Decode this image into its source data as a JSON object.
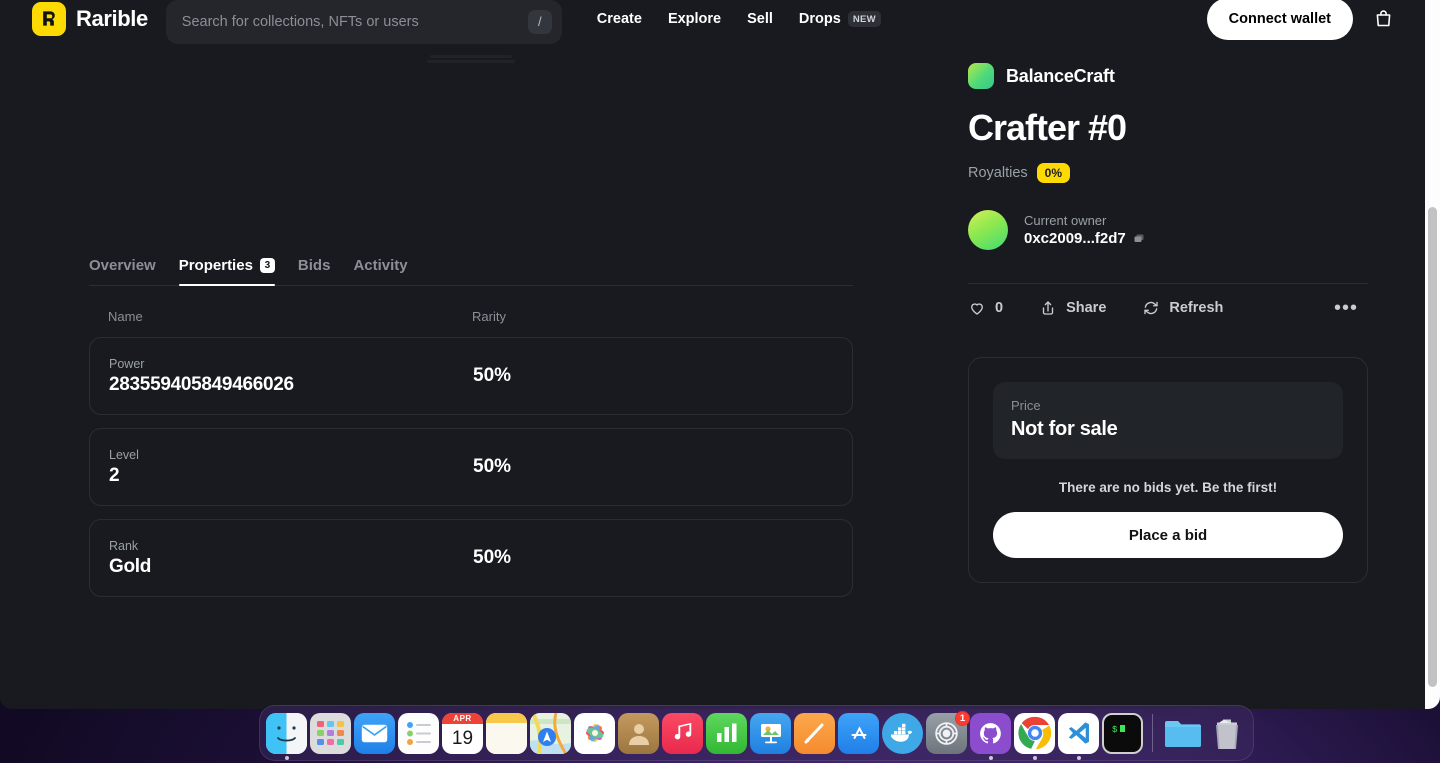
{
  "header": {
    "brand_name": "Rarible",
    "brand_logo": "rarible-logo-icon",
    "search": {
      "placeholder": "Search for collections, NFTs or users",
      "value": "",
      "shortcut_badge": "/"
    },
    "nav": [
      {
        "label": "Create",
        "badge": ""
      },
      {
        "label": "Explore",
        "badge": ""
      },
      {
        "label": "Sell",
        "badge": ""
      },
      {
        "label": "Drops",
        "badge": "NEW"
      }
    ],
    "connect_wallet_label": "Connect wallet",
    "cart_icon": "shopping-bag-icon"
  },
  "tabs": [
    {
      "label": "Overview",
      "count": "",
      "active": false
    },
    {
      "label": "Properties",
      "count": "3",
      "active": true
    },
    {
      "label": "Bids",
      "count": "",
      "active": false
    },
    {
      "label": "Activity",
      "count": "",
      "active": false
    }
  ],
  "properties": {
    "columns": {
      "name": "Name",
      "rarity": "Rarity"
    },
    "rows": [
      {
        "trait": "Power",
        "value": "283559405849466026",
        "rarity": "50%"
      },
      {
        "trait": "Level",
        "value": "2",
        "rarity": "50%"
      },
      {
        "trait": "Rank",
        "value": "Gold",
        "rarity": "50%"
      }
    ]
  },
  "detail": {
    "collection_name": "BalanceCraft",
    "title": "Crafter #0",
    "royalties_label": "Royalties",
    "royalties_value": "0%",
    "owner_label": "Current owner",
    "owner_address": "0xc2009...f2d7",
    "copy_icon": "copy-icon"
  },
  "actions": {
    "like_count": "0",
    "like_icon": "heart-icon",
    "share_label": "Share",
    "share_icon": "share-icon",
    "refresh_label": "Refresh",
    "refresh_icon": "refresh-icon",
    "more_label": "•••"
  },
  "buy_card": {
    "price_label": "Price",
    "price_value": "Not for sale",
    "no_bids_text": "There are no bids yet. Be the first!",
    "place_bid_label": "Place a bid"
  },
  "dock": {
    "items": [
      {
        "name": "finder",
        "running": true
      },
      {
        "name": "launchpad",
        "running": false
      },
      {
        "name": "mail",
        "running": false
      },
      {
        "name": "reminders",
        "running": false
      },
      {
        "name": "calendar",
        "running": false,
        "month": "APR",
        "day": "19"
      },
      {
        "name": "notes",
        "running": false
      },
      {
        "name": "maps",
        "running": false
      },
      {
        "name": "photos",
        "running": false
      },
      {
        "name": "contacts",
        "running": false
      },
      {
        "name": "music",
        "running": false
      },
      {
        "name": "numbers",
        "running": false
      },
      {
        "name": "keynote",
        "running": false
      },
      {
        "name": "freeform",
        "running": false
      },
      {
        "name": "app-store",
        "running": false
      },
      {
        "name": "docker",
        "running": false
      },
      {
        "name": "settings",
        "running": false,
        "badge": "1"
      },
      {
        "name": "github-desktop",
        "running": true
      },
      {
        "name": "google-chrome",
        "running": true
      },
      {
        "name": "visual-studio-code",
        "running": true
      },
      {
        "name": "terminal",
        "running": false
      },
      {
        "name": "downloads-folder",
        "running": false
      },
      {
        "name": "trash",
        "running": false
      }
    ]
  },
  "colors": {
    "brand_yellow": "#feda03",
    "page_bg": "#181a1f",
    "card_border": "#2a2d33",
    "muted_text": "#8b8f98",
    "accent_white": "#ffffff"
  }
}
